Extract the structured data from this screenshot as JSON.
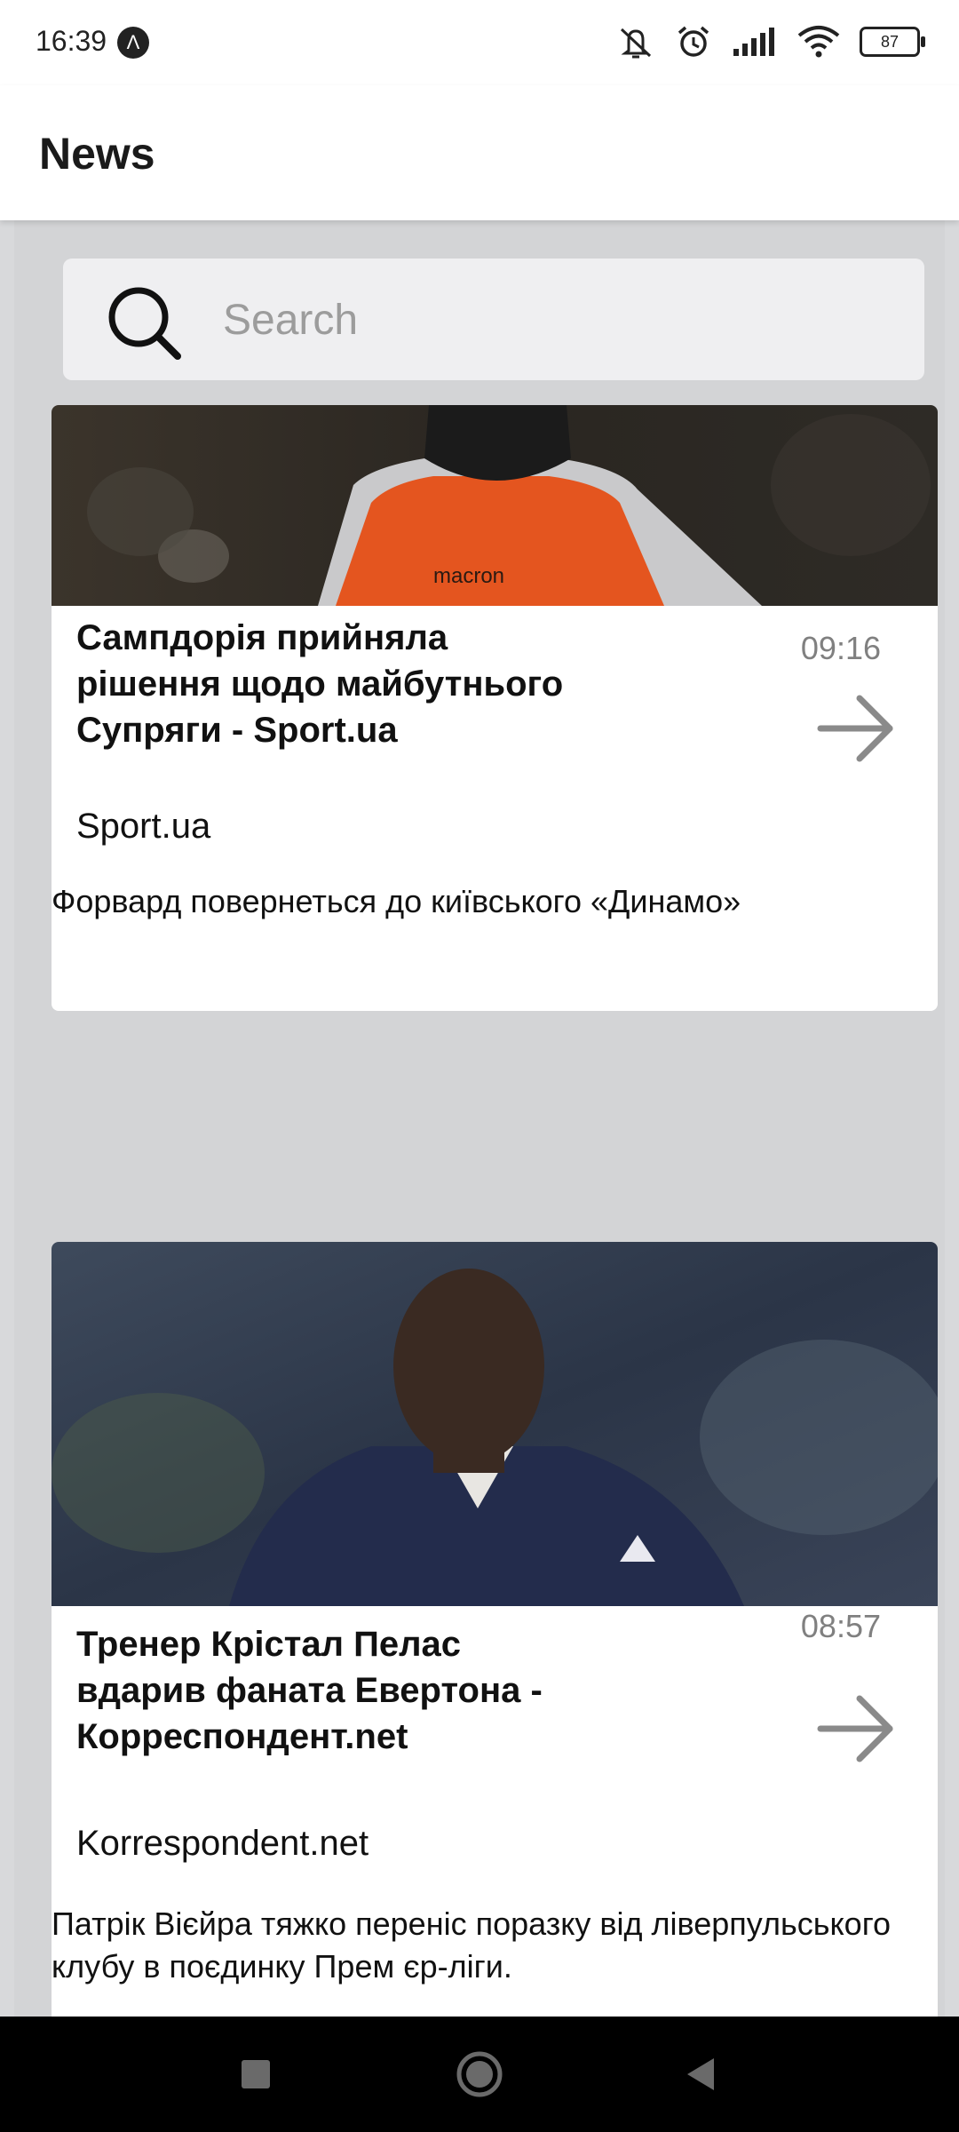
{
  "status_bar": {
    "time": "16:39",
    "notification_badge": "Λ",
    "battery": "87",
    "icons": [
      "mute-notification-icon",
      "alarm-icon",
      "signal-icon",
      "wifi-icon",
      "battery-icon"
    ]
  },
  "app_bar": {
    "title": "News"
  },
  "search": {
    "placeholder": "Search",
    "value": ""
  },
  "articles": [
    {
      "title": "Сампдорія прийняла рішення щодо майбутнього Супряги - Sport.ua",
      "time": "09:16",
      "source": "Sport.ua",
      "description": "Форвард повернеться до київського «Динамо»",
      "image_desc": "player in orange training bib"
    },
    {
      "title": "Тренер Крістал Пелас вдарив фаната Евертона - Корреспондент.net",
      "time": "08:57",
      "source": "Korrespondent.net",
      "description": "Патрік Вієйра тяжко переніс поразку від ліверпульського клубу в поєдинку Прем єр-ліги.",
      "image_desc": "coach in navy jacket"
    }
  ],
  "nav_bar": {
    "items": [
      "recent-apps-button",
      "home-button",
      "back-button"
    ]
  },
  "colors": {
    "background": "#d8d9db",
    "card": "#ffffff",
    "search_bg": "#efeff1",
    "time_text": "#808080",
    "arrow": "#8a8a8a"
  }
}
